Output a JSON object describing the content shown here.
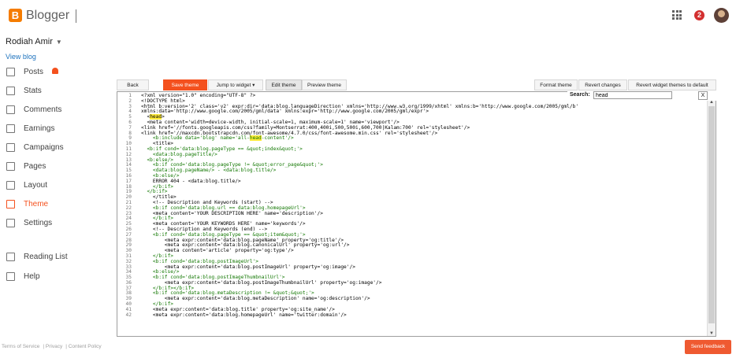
{
  "app": {
    "brand": "Blogger",
    "notifications": "2"
  },
  "user": {
    "name": "Rodiah Amir",
    "view_blog": "View blog"
  },
  "nav": [
    {
      "label": "Posts",
      "icon": "posts-icon"
    },
    {
      "label": "Stats",
      "icon": "stats-icon"
    },
    {
      "label": "Comments",
      "icon": "comments-icon"
    },
    {
      "label": "Earnings",
      "icon": "earnings-icon"
    },
    {
      "label": "Campaigns",
      "icon": "campaigns-icon"
    },
    {
      "label": "Pages",
      "icon": "pages-icon"
    },
    {
      "label": "Layout",
      "icon": "layout-icon"
    },
    {
      "label": "Theme",
      "icon": "theme-icon",
      "active": true
    },
    {
      "label": "Settings",
      "icon": "settings-icon"
    },
    {
      "label": "Reading List",
      "icon": "reading-list-icon"
    },
    {
      "label": "Help",
      "icon": "help-icon"
    }
  ],
  "toolbar": {
    "back": "Back",
    "save": "Save theme",
    "jump": "Jump to widget",
    "edit": "Edit theme",
    "preview": "Preview theme",
    "format": "Format theme",
    "revert": "Revert changes",
    "revert_widgets": "Revert widget themes to default"
  },
  "search": {
    "label": "Search:",
    "value": "head",
    "close": "X"
  },
  "footer": {
    "terms": "Terms of Service",
    "privacy": "Privacy",
    "policy": "Content Policy",
    "feedback": "Send feedback"
  },
  "code_lines": [
    "<?xml version=\"1.0\" encoding=\"UTF-8\" ?>",
    "<!DOCTYPE html>",
    "<html b:version='2' class='v2' expr:dir='data:blog.languageDirection' xmlns='http://www.w3.org/1999/xhtml' xmlns:b='http://www.google.com/2005/gml/b'",
    "xmlns:data='http://www.google.com/2005/gml/data' xmlns:expr='http://www.google.com/2005/gml/expr'>",
    "  <head>",
    "  <meta content='width=device-width, initial-scale=1, maximum-scale=1' name='viewport'/>",
    "<link href='//fonts.googleapis.com/css?family=Montserrat:400,400i,500,500i,600,700|Kalam:700' rel='stylesheet'/>",
    "<link href='//maxcdn.bootstrapcdn.com/font-awesome/4.7.0/css/font-awesome.min.css' rel='stylesheet'/>",
    "    <b:include data='blog' name='all-head-content'/>",
    "    <title>",
    "  <b:if cond='data:blog.pageType == &quot;index&quot;'>",
    "    <data:blog.pageTitle/>",
    "  <b:else/>",
    "    <b:if cond='data:blog.pageType != &quot;error_page&quot;'>",
    "    <data:blog.pageName/> - <data:blog.title/>",
    "    <b:else/>",
    "    ERROR 404 - <data:blog.title/>",
    "    </b:if>",
    "  </b:if>",
    "    </title>",
    "    <!-- Description and Keywords (start) -->",
    "    <b:if cond='data:blog.url == data:blog.homepageUrl'>",
    "    <meta content='YOUR DESCRIPTION HERE' name='description'/>",
    "    </b:if>",
    "    <meta content='YOUR KEYWORDS HERE' name='keywords'/>",
    "    <!-- Description and Keywords (end) -->",
    "    <b:if cond='data:blog.pageType == &quot;item&quot;'>",
    "        <meta expr:content='data:blog.pageName' property='og:title'/>",
    "        <meta expr:content='data:blog.canonicalUrl' property='og:url'/>",
    "        <meta content='article' property='og:type'/>",
    "    </b:if>",
    "    <b:if cond='data:blog.postImageUrl'>",
    "        <meta expr:content='data:blog.postImageUrl' property='og:image'/>",
    "    <b:else/>",
    "    <b:if cond='data:blog.postImageThumbnailUrl'>",
    "        <meta expr:content='data:blog.postImageThumbnailUrl' property='og:image'/>",
    "    </b:if></b:if>",
    "    <b:if cond='data:blog.metaDescription != &quot;&quot;'>",
    "        <meta expr:content='data:blog.metaDescription' name='og:description'/>",
    "    </b:if>",
    "    <meta expr:content='data:blog.title' property='og:site_name'/>",
    "    <meta expr:content='data:blog.homepageUrl' name='twitter:domain'/>"
  ],
  "colors": {
    "accent": "#f4511e",
    "brand": "#f57c00",
    "link": "#1e73be",
    "highlight": "#ffeb3b"
  }
}
